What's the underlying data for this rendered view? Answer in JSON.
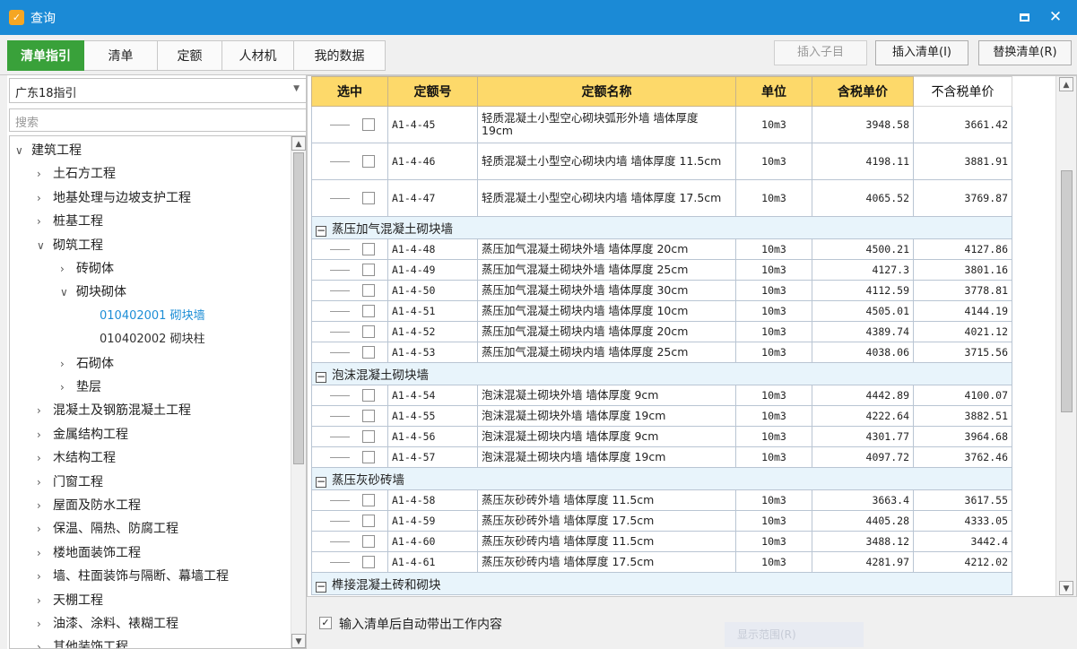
{
  "window": {
    "title": "查询",
    "app_icon_glyph": "✓"
  },
  "toolbar": {
    "tabs": [
      "清单指引",
      "清单",
      "定额",
      "人材机",
      "我的数据"
    ],
    "active_tab": 0,
    "buttons": {
      "insert_child": "插入子目",
      "insert_list": "插入清单(I)",
      "replace_list": "替换清单(R)"
    }
  },
  "left": {
    "select_value": "广东18指引",
    "search_placeholder": "搜索",
    "tree": [
      {
        "label": "建筑工程",
        "level": 0,
        "expanded": true
      },
      {
        "label": "土石方工程",
        "level": 1,
        "expanded": false
      },
      {
        "label": "地基处理与边坡支护工程",
        "level": 1,
        "expanded": false
      },
      {
        "label": "桩基工程",
        "level": 1,
        "expanded": false
      },
      {
        "label": "砌筑工程",
        "level": 1,
        "expanded": true
      },
      {
        "label": "砖砌体",
        "level": 2,
        "expanded": false
      },
      {
        "label": "砌块砌体",
        "level": 2,
        "expanded": true
      },
      {
        "label": "010402001   砌块墙",
        "level": 3,
        "leaf": true,
        "selected": true
      },
      {
        "label": "010402002   砌块柱",
        "level": 3,
        "leaf": true
      },
      {
        "label": "石砌体",
        "level": 2,
        "expanded": false
      },
      {
        "label": "垫层",
        "level": 2,
        "expanded": false
      },
      {
        "label": "混凝土及钢筋混凝土工程",
        "level": 1,
        "expanded": false
      },
      {
        "label": "金属结构工程",
        "level": 1,
        "expanded": false
      },
      {
        "label": "木结构工程",
        "level": 1,
        "expanded": false
      },
      {
        "label": "门窗工程",
        "level": 1,
        "expanded": false
      },
      {
        "label": "屋面及防水工程",
        "level": 1,
        "expanded": false
      },
      {
        "label": "保温、隔热、防腐工程",
        "level": 1,
        "expanded": false
      },
      {
        "label": "楼地面装饰工程",
        "level": 1,
        "expanded": false
      },
      {
        "label": "墙、柱面装饰与隔断、幕墙工程",
        "level": 1,
        "expanded": false
      },
      {
        "label": "天棚工程",
        "level": 1,
        "expanded": false
      },
      {
        "label": "油漆、涂料、裱糊工程",
        "level": 1,
        "expanded": false
      },
      {
        "label": "其他装饰工程",
        "level": 1,
        "expanded": false
      }
    ]
  },
  "grid": {
    "headers": [
      "选中",
      "定额号",
      "定额名称",
      "单位",
      "含税单价",
      "不含税单价"
    ],
    "rows": [
      {
        "type": "item",
        "code": "A1-4-45",
        "name": "轻质混凝土小型空心砌块弧形外墙 墙体厚度 19cm",
        "unit": "10m3",
        "price_tax": "3948.58",
        "price_notax": "3661.42",
        "tall": true
      },
      {
        "type": "item",
        "code": "A1-4-46",
        "name": "轻质混凝土小型空心砌块内墙 墙体厚度 11.5cm",
        "unit": "10m3",
        "price_tax": "4198.11",
        "price_notax": "3881.91",
        "tall": true
      },
      {
        "type": "item",
        "code": "A1-4-47",
        "name": "轻质混凝土小型空心砌块内墙 墙体厚度 17.5cm",
        "unit": "10m3",
        "price_tax": "4065.52",
        "price_notax": "3769.87",
        "tall": true
      },
      {
        "type": "group",
        "label": "蒸压加气混凝土砌块墙"
      },
      {
        "type": "item",
        "code": "A1-4-48",
        "name": "蒸压加气混凝土砌块外墙 墙体厚度 20cm",
        "unit": "10m3",
        "price_tax": "4500.21",
        "price_notax": "4127.86"
      },
      {
        "type": "item",
        "code": "A1-4-49",
        "name": "蒸压加气混凝土砌块外墙 墙体厚度 25cm",
        "unit": "10m3",
        "price_tax": "4127.3",
        "price_notax": "3801.16"
      },
      {
        "type": "item",
        "code": "A1-4-50",
        "name": "蒸压加气混凝土砌块外墙 墙体厚度 30cm",
        "unit": "10m3",
        "price_tax": "4112.59",
        "price_notax": "3778.81"
      },
      {
        "type": "item",
        "code": "A1-4-51",
        "name": "蒸压加气混凝土砌块内墙 墙体厚度 10cm",
        "unit": "10m3",
        "price_tax": "4505.01",
        "price_notax": "4144.19"
      },
      {
        "type": "item",
        "code": "A1-4-52",
        "name": "蒸压加气混凝土砌块内墙 墙体厚度 20cm",
        "unit": "10m3",
        "price_tax": "4389.74",
        "price_notax": "4021.12"
      },
      {
        "type": "item",
        "code": "A1-4-53",
        "name": "蒸压加气混凝土砌块内墙 墙体厚度 25cm",
        "unit": "10m3",
        "price_tax": "4038.06",
        "price_notax": "3715.56"
      },
      {
        "type": "group",
        "label": "泡沫混凝土砌块墙"
      },
      {
        "type": "item",
        "code": "A1-4-54",
        "name": "泡沫混凝土砌块外墙 墙体厚度 9cm",
        "unit": "10m3",
        "price_tax": "4442.89",
        "price_notax": "4100.07"
      },
      {
        "type": "item",
        "code": "A1-4-55",
        "name": "泡沫混凝土砌块外墙 墙体厚度 19cm",
        "unit": "10m3",
        "price_tax": "4222.64",
        "price_notax": "3882.51"
      },
      {
        "type": "item",
        "code": "A1-4-56",
        "name": "泡沫混凝土砌块内墙 墙体厚度 9cm",
        "unit": "10m3",
        "price_tax": "4301.77",
        "price_notax": "3964.68"
      },
      {
        "type": "item",
        "code": "A1-4-57",
        "name": "泡沫混凝土砌块内墙 墙体厚度 19cm",
        "unit": "10m3",
        "price_tax": "4097.72",
        "price_notax": "3762.46"
      },
      {
        "type": "group",
        "label": "蒸压灰砂砖墙"
      },
      {
        "type": "item",
        "code": "A1-4-58",
        "name": "蒸压灰砂砖外墙 墙体厚度 11.5cm",
        "unit": "10m3",
        "price_tax": "3663.4",
        "price_notax": "3617.55"
      },
      {
        "type": "item",
        "code": "A1-4-59",
        "name": "蒸压灰砂砖外墙 墙体厚度 17.5cm",
        "unit": "10m3",
        "price_tax": "4405.28",
        "price_notax": "4333.05"
      },
      {
        "type": "item",
        "code": "A1-4-60",
        "name": "蒸压灰砂砖内墙 墙体厚度 11.5cm",
        "unit": "10m3",
        "price_tax": "3488.12",
        "price_notax": "3442.4"
      },
      {
        "type": "item",
        "code": "A1-4-61",
        "name": "蒸压灰砂砖内墙 墙体厚度 17.5cm",
        "unit": "10m3",
        "price_tax": "4281.97",
        "price_notax": "4212.02"
      },
      {
        "type": "group",
        "label": "榫接混凝土砖和砌块"
      }
    ]
  },
  "bottom": {
    "checkbox_label": "输入清单后自动带出工作内容",
    "checkbox_checked": true,
    "faint_text": "显示范围(R)"
  },
  "colors": {
    "titlebar": "#1b8ad6",
    "active_tab": "#39a13a",
    "header": "#fdd96a",
    "group_row": "#e8f4fb",
    "tree_selected": "#1e8ed6"
  }
}
